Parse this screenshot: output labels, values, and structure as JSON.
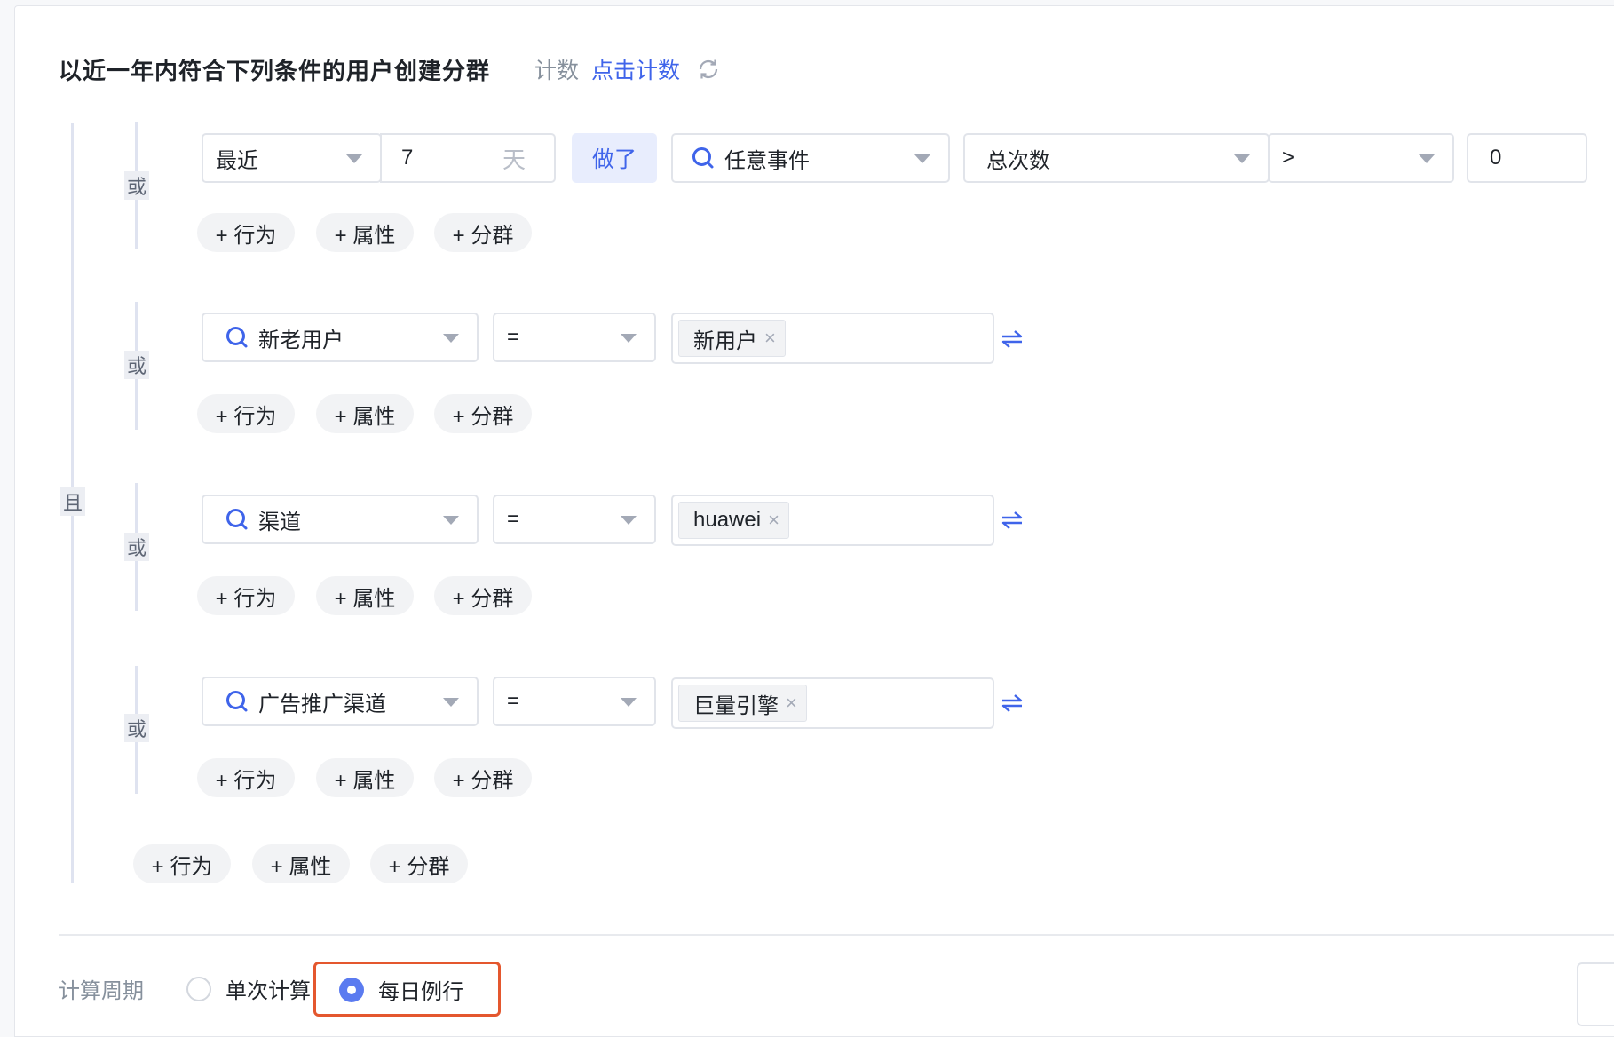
{
  "header": {
    "title": "以近一年内符合下列条件的用户创建分群",
    "count_label": "计数",
    "count_link": "点击计数"
  },
  "logic": {
    "and": "且",
    "or": "或"
  },
  "add_buttons": {
    "behavior": "+ 行为",
    "property": "+ 属性",
    "segment": "+ 分群"
  },
  "row1": {
    "time_select": "最近",
    "days_value": "7",
    "days_unit": "天",
    "did_button": "做了",
    "event_select": "任意事件",
    "metric_select": "总次数",
    "operator_select": ">",
    "threshold_value": "0"
  },
  "row2": {
    "property": "新老用户",
    "operator": "=",
    "tag": "新用户"
  },
  "row3": {
    "property": "渠道",
    "operator": "=",
    "tag": "huawei"
  },
  "row4": {
    "property": "广告推广渠道",
    "operator": "=",
    "tag": "巨量引擎"
  },
  "tag_remove_glyph": "×",
  "period": {
    "label": "计算周期",
    "options": [
      "单次计算",
      "每日例行"
    ],
    "selected": "每日例行"
  },
  "colors": {
    "accent": "#3f64ea",
    "radio_checked": "#5b7bf0",
    "highlight_border": "#e4572e"
  },
  "icons": {
    "refresh": "refresh-icon",
    "search": "search-icon",
    "swap": "swap-icon",
    "caret": "caret-down-icon"
  }
}
